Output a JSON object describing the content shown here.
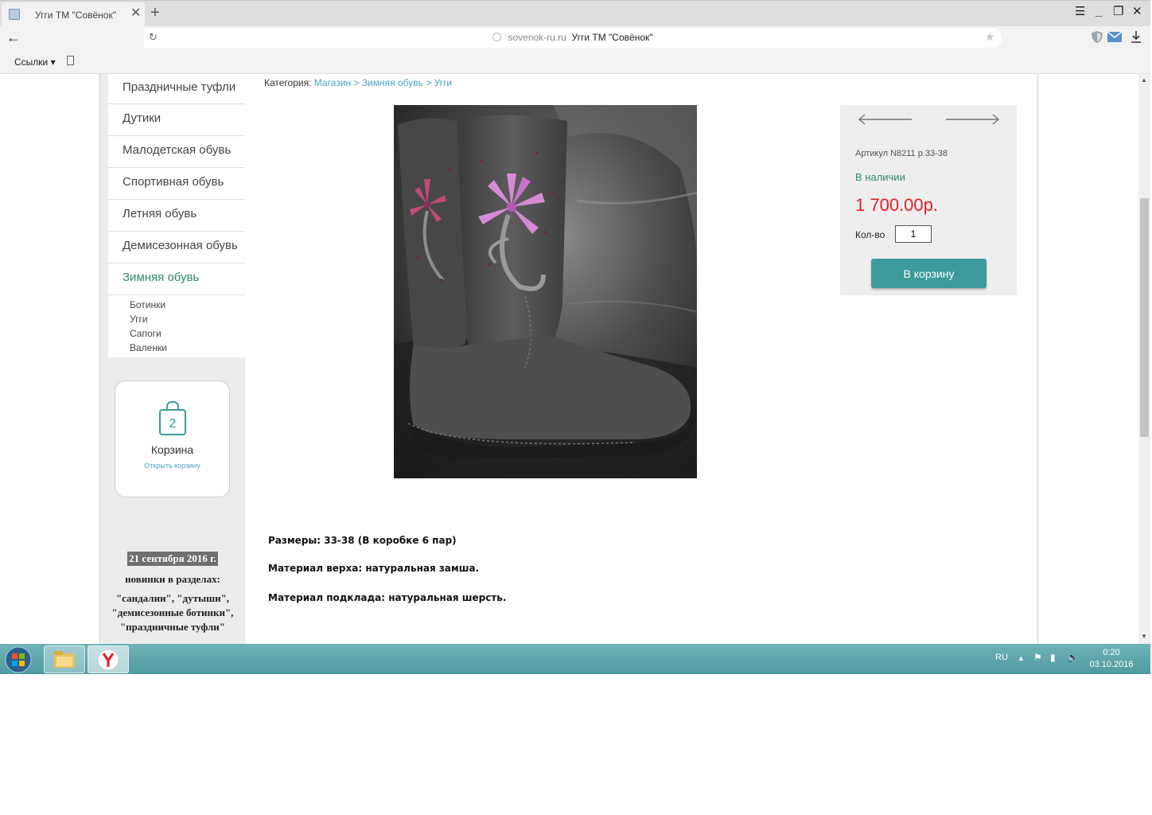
{
  "browser": {
    "tab_title": "Угги ТМ \"Совёнок\"",
    "tab_close": "✕",
    "new_tab": "+",
    "address_domain": "sovenok-ru.ru",
    "address_title": "Угги ТМ \"Совёнок\"",
    "bookmarks_label": "Ссылки ▾"
  },
  "sidebar": {
    "menu_items": [
      {
        "label": "Праздничные туфли"
      },
      {
        "label": "Дутики"
      },
      {
        "label": "Малодетская обувь"
      },
      {
        "label": "Спортивная обувь"
      },
      {
        "label": "Летняя обувь"
      },
      {
        "label": "Демисезонная обувь"
      },
      {
        "label": "Зимняя обувь"
      }
    ],
    "sub_items": [
      {
        "label": "Ботинки"
      },
      {
        "label": "Угги"
      },
      {
        "label": "Сапоги"
      },
      {
        "label": "Валенки"
      }
    ],
    "cart": {
      "count": "2",
      "label": "Корзина",
      "open_link": "Открыть корзину"
    },
    "news": {
      "date": "21 сентября 2016 г.",
      "line1": "новинки в разделах:",
      "line2": "\"сандалии\", \"дутыши\", \"демисезонные ботинки\",",
      "line3": "\"праздничные туфли\""
    }
  },
  "breadcrumb": {
    "prefix": "Категория:",
    "items": [
      "Магазин",
      "Зимняя обувь",
      "Угги"
    ],
    "sep": ">"
  },
  "product": {
    "article": "Артикул N8211 р.33-38",
    "stock": "В наличии",
    "price": "1 700.00р.",
    "qty_label": "Кол-во",
    "qty_value": "1",
    "add_to_cart": "В корзину"
  },
  "description": {
    "sizes": "Размеры: 33-38 (В коробке 6 пар)",
    "upper": "Материал верха: натуральная замша.",
    "lining": "Материал подклада: натуральная шерсть."
  },
  "taskbar": {
    "lang": "RU",
    "time": "0:20",
    "date": "03.10.2016"
  },
  "colors": {
    "accent_green": "#2f8b6b",
    "link_blue": "#4aa3c9",
    "price_red": "#e41f26",
    "button_teal": "#3c9a9a"
  }
}
